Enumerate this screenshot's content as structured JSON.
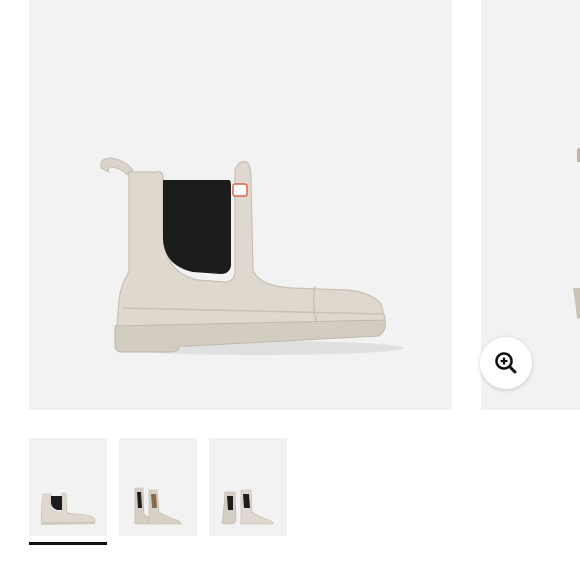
{
  "gallery": {
    "main_image": {
      "icon": "chelsea-boot-image",
      "boot_color": "#dcd6cc",
      "panel_color": "#1c1c1c",
      "background": "#f2f2f2"
    },
    "zoom_button": {
      "icon": "zoom-in-icon"
    },
    "thumbnails": [
      {
        "view": "side",
        "active": true
      },
      {
        "view": "pair-angle",
        "active": false
      },
      {
        "view": "pair-front",
        "active": false
      }
    ]
  }
}
